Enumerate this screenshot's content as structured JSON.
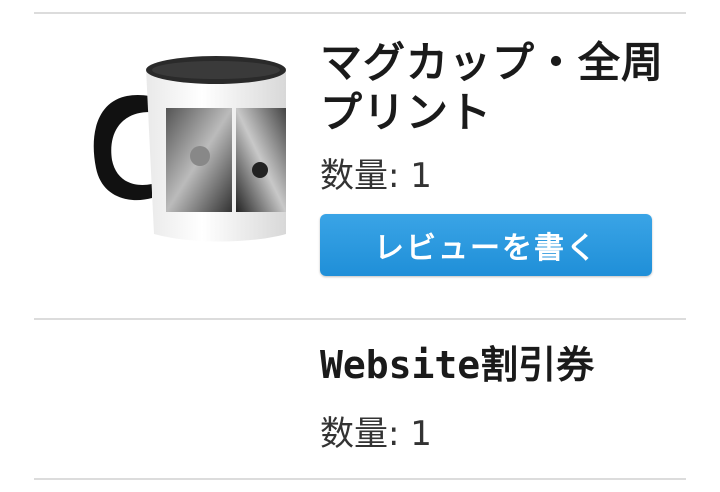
{
  "items": [
    {
      "title": "マグカップ・全周プリント",
      "quantity_label": "数量:",
      "quantity_value": "1",
      "review_button": "レビューを書く",
      "thumbnail_icon": "mug-product-image"
    },
    {
      "title": "Website割引券",
      "quantity_label": "数量:",
      "quantity_value": "1"
    }
  ],
  "colors": {
    "button_blue": "#2596df",
    "divider": "#dcdcdc"
  }
}
